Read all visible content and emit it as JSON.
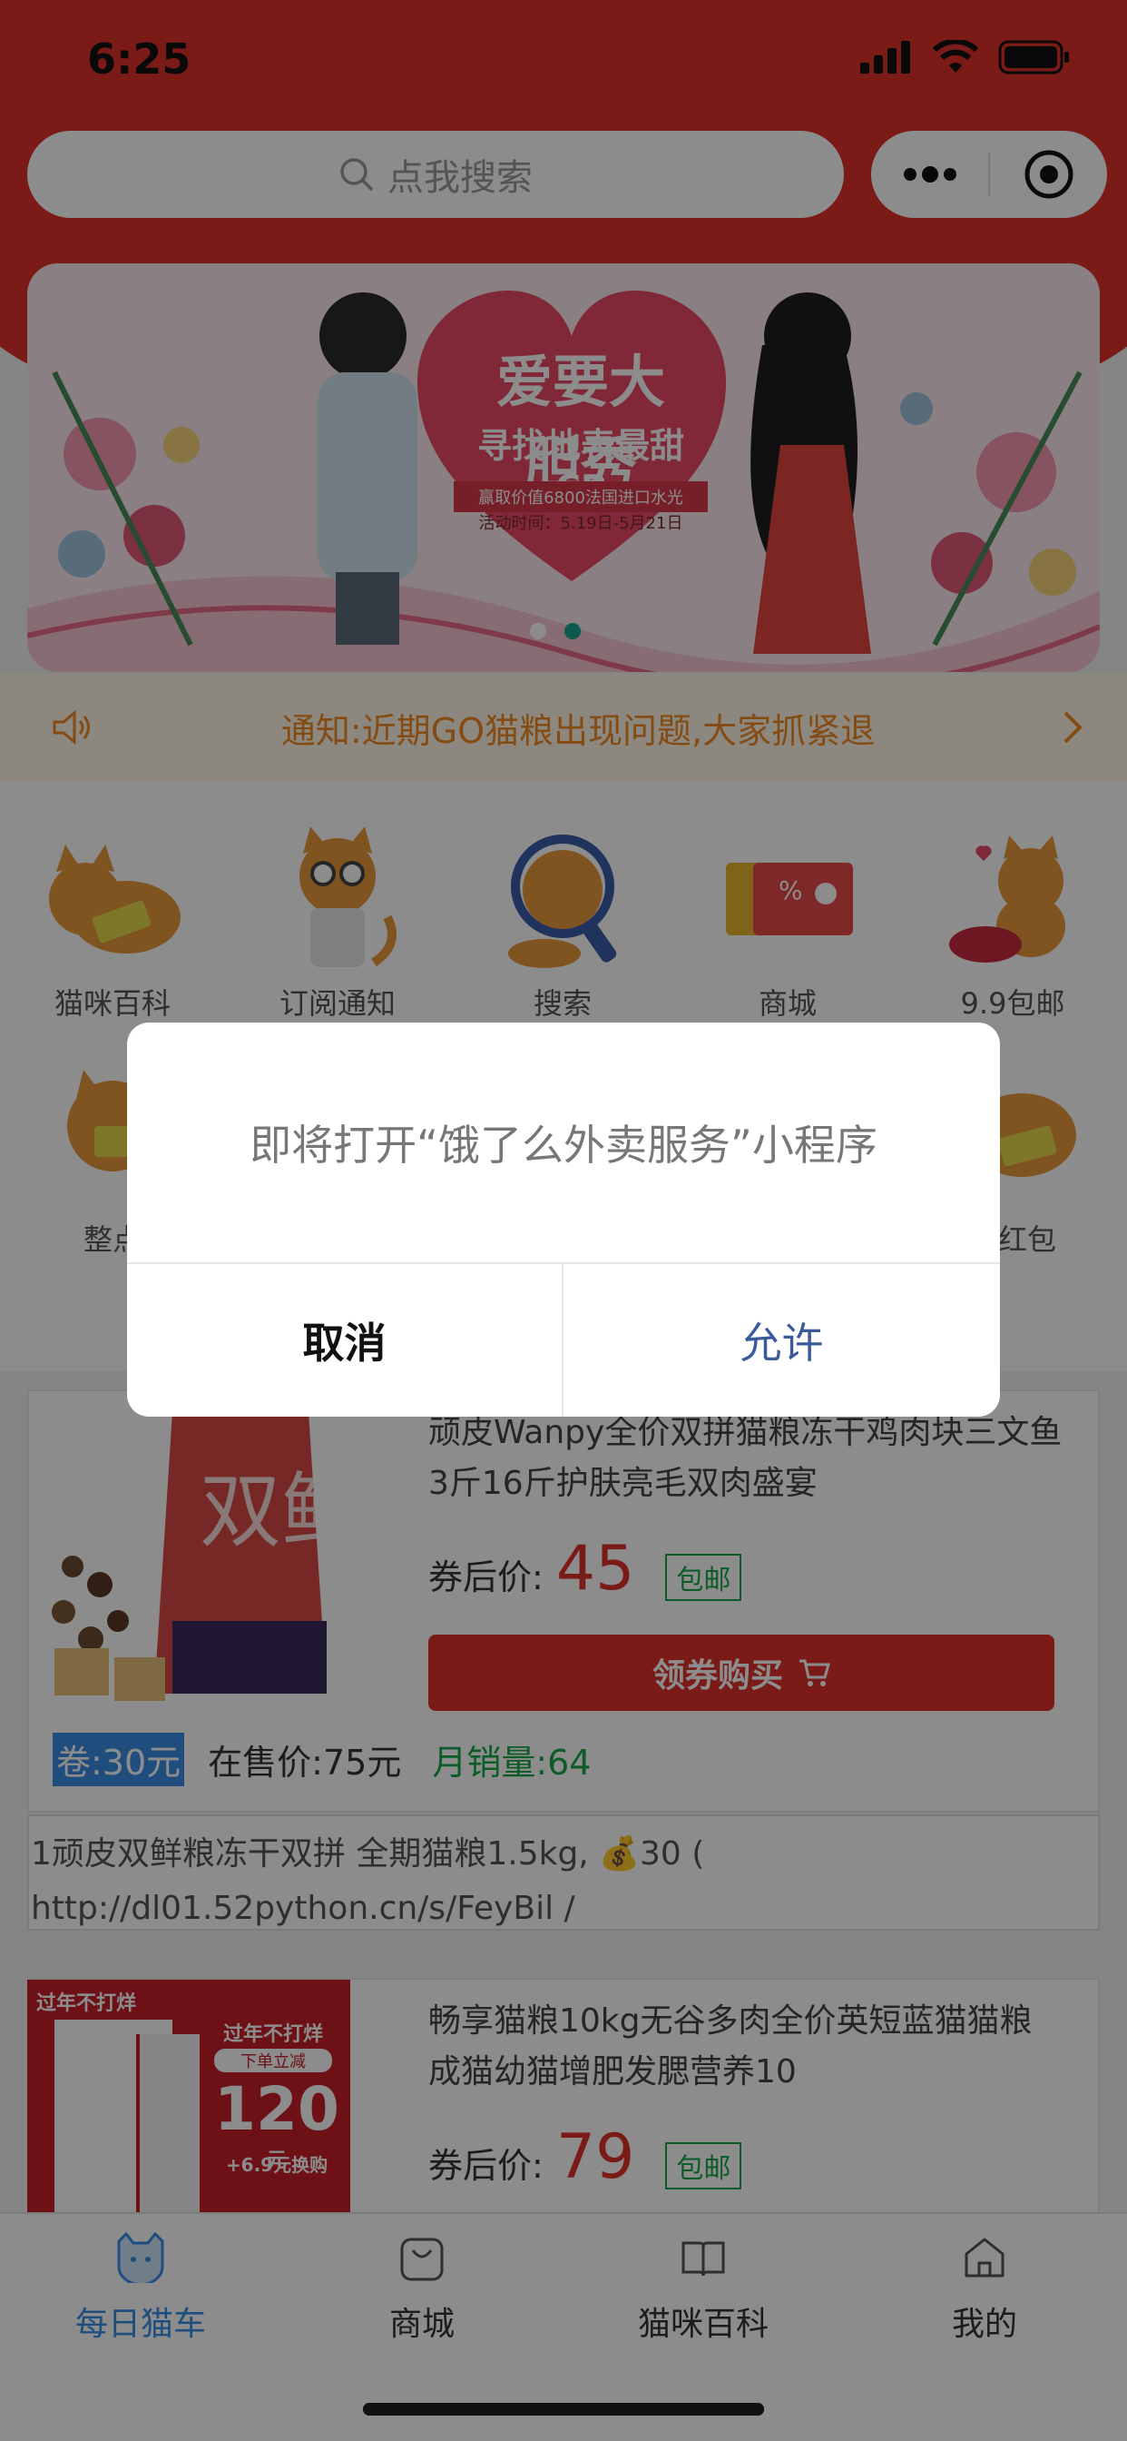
{
  "status_bar": {
    "time": "6:25"
  },
  "search": {
    "placeholder": "点我搜索"
  },
  "banner": {
    "title": "爱要大胆秀",
    "subtitle": "寻找地表最甜CP",
    "prize": "赢取价值6800法国进口水光",
    "date": "活动时间：5.19日-5月21日"
  },
  "notice": {
    "text": "通知:近期GO猫粮出现问题,大家抓紧退"
  },
  "grid": {
    "row1": [
      "猫咪百科",
      "订阅通知",
      "搜索",
      "商城",
      "9.9包邮"
    ],
    "row2": [
      "整点",
      "团红包"
    ]
  },
  "products": [
    {
      "title": "顽皮Wanpy全价双拼猫粮冻干鸡肉块三文鱼3斤16斤护肤亮毛双肉盛宴",
      "price_label": "券后价:",
      "price": "45",
      "shipping": "包邮",
      "buy": "领券购买",
      "coupon": "卷:30元",
      "on_sale": "在售价:75元",
      "monthly_sales": "月销量:64",
      "package_text": "双鲜",
      "description": "1顽皮双鲜粮冻干双拼 全期猫粮1.5kg, 💰30 ( http://dl01.52python.cn/s/FeyBil /"
    },
    {
      "title": "畅享猫粮10kg无谷多肉全价英短蓝猫猫粮成猫幼猫增肥发腮营养10",
      "price_label": "券后价:",
      "price": "79",
      "shipping": "包邮",
      "promo_1": "过年不打烊",
      "promo_2": "下单立减",
      "promo_3": "120",
      "promo_4": "元",
      "promo_5": "+6.9元换购"
    }
  ],
  "tabbar": [
    {
      "label": "每日猫车",
      "icon": "cat-face-icon"
    },
    {
      "label": "商城",
      "icon": "bag-icon"
    },
    {
      "label": "猫咪百科",
      "icon": "book-icon"
    },
    {
      "label": "我的",
      "icon": "home-icon"
    }
  ],
  "dialog": {
    "message": "即将打开“饿了么外卖服务”小程序",
    "cancel": "取消",
    "allow": "允许"
  },
  "colors": {
    "brand": "#e0322a",
    "notice": "#f08a24",
    "active_tab": "#3a8ee6",
    "green": "#18a84a"
  }
}
